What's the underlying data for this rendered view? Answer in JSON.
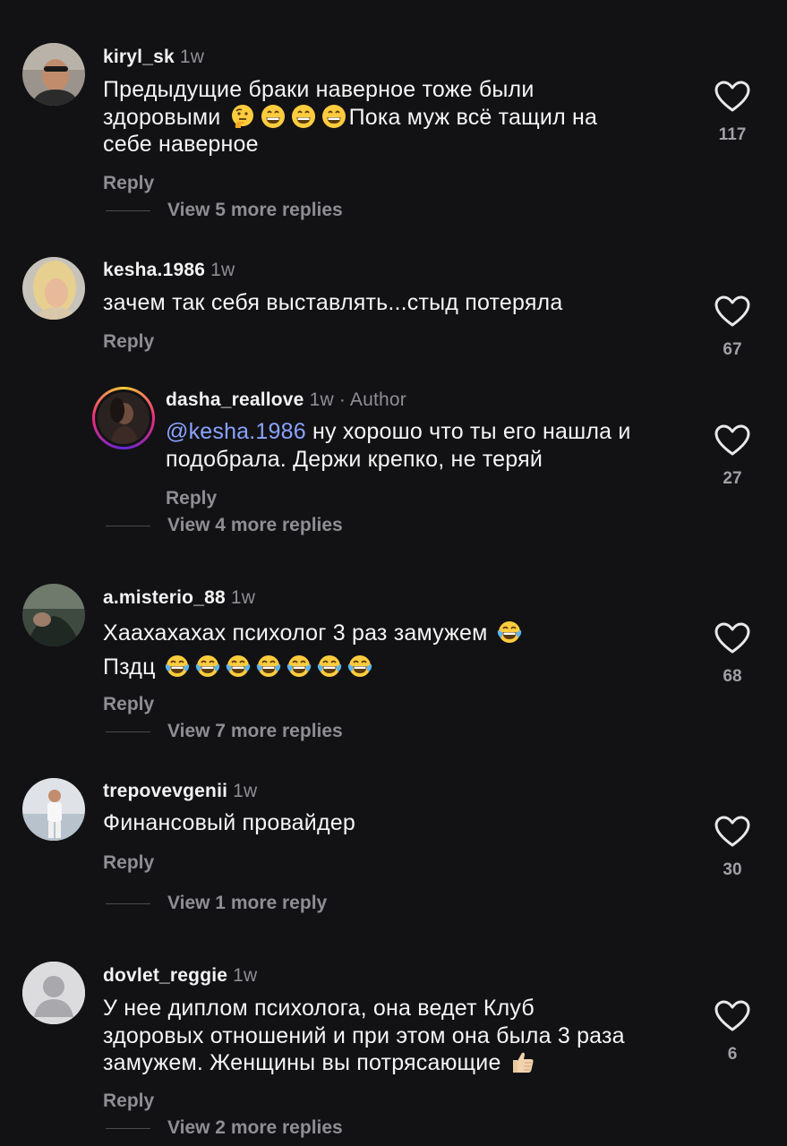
{
  "comments": [
    {
      "username": "kiryl_sk",
      "time": "1w",
      "text_line1": "Предыдущие браки наверное тоже были",
      "text_line2a": "здоровыми",
      "text_line2b": "Пока муж всё тащил на",
      "text_line3": "себе наверное",
      "reply_label": "Reply",
      "view_more": "View 5 more replies",
      "likes": "117"
    },
    {
      "username": "kesha.1986",
      "time": "1w",
      "text_line1": "зачем так себя выставлять...стыд потеряла",
      "reply_label": "Reply",
      "likes": "67"
    },
    {
      "username": "dasha_reallove",
      "time": "1w",
      "author_tag": " · Author",
      "mention": "@kesha.1986",
      "text_line1": " ну хорошо что ты его нашла и",
      "text_line2": "подобрала. Держи крепко, не теряй",
      "reply_label": "Reply",
      "view_more": "View 4 more replies",
      "likes": "27"
    },
    {
      "username": "a.misterio_88",
      "time": "1w",
      "text_line1": "Хаахахахах психолог 3 раз замужем",
      "text_line2": "Пздц",
      "reply_label": "Reply",
      "view_more": "View 7 more replies",
      "likes": "68"
    },
    {
      "username": "trepovevgenii",
      "time": "1w",
      "text_line1": "Финансовый провайдер",
      "reply_label": "Reply",
      "view_more": "View 1 more reply",
      "likes": "30"
    },
    {
      "username": "dovlet_reggie",
      "time": "1w",
      "text_line1": "У нее диплом психолога, она ведет Клуб",
      "text_line2": "здоровых отношений и при этом она была 3 раза",
      "text_line3": "замужем. Женщины вы потрясающие",
      "reply_label": "Reply",
      "view_more": "View 2 more replies",
      "likes": "6"
    }
  ],
  "icons": {
    "like": "heart-outline-icon",
    "thinking": "thinking-face-emoji",
    "grin": "grinning-face-emoji",
    "laugh": "tears-of-joy-emoji",
    "thumbs": "thumbs-up-emoji"
  }
}
